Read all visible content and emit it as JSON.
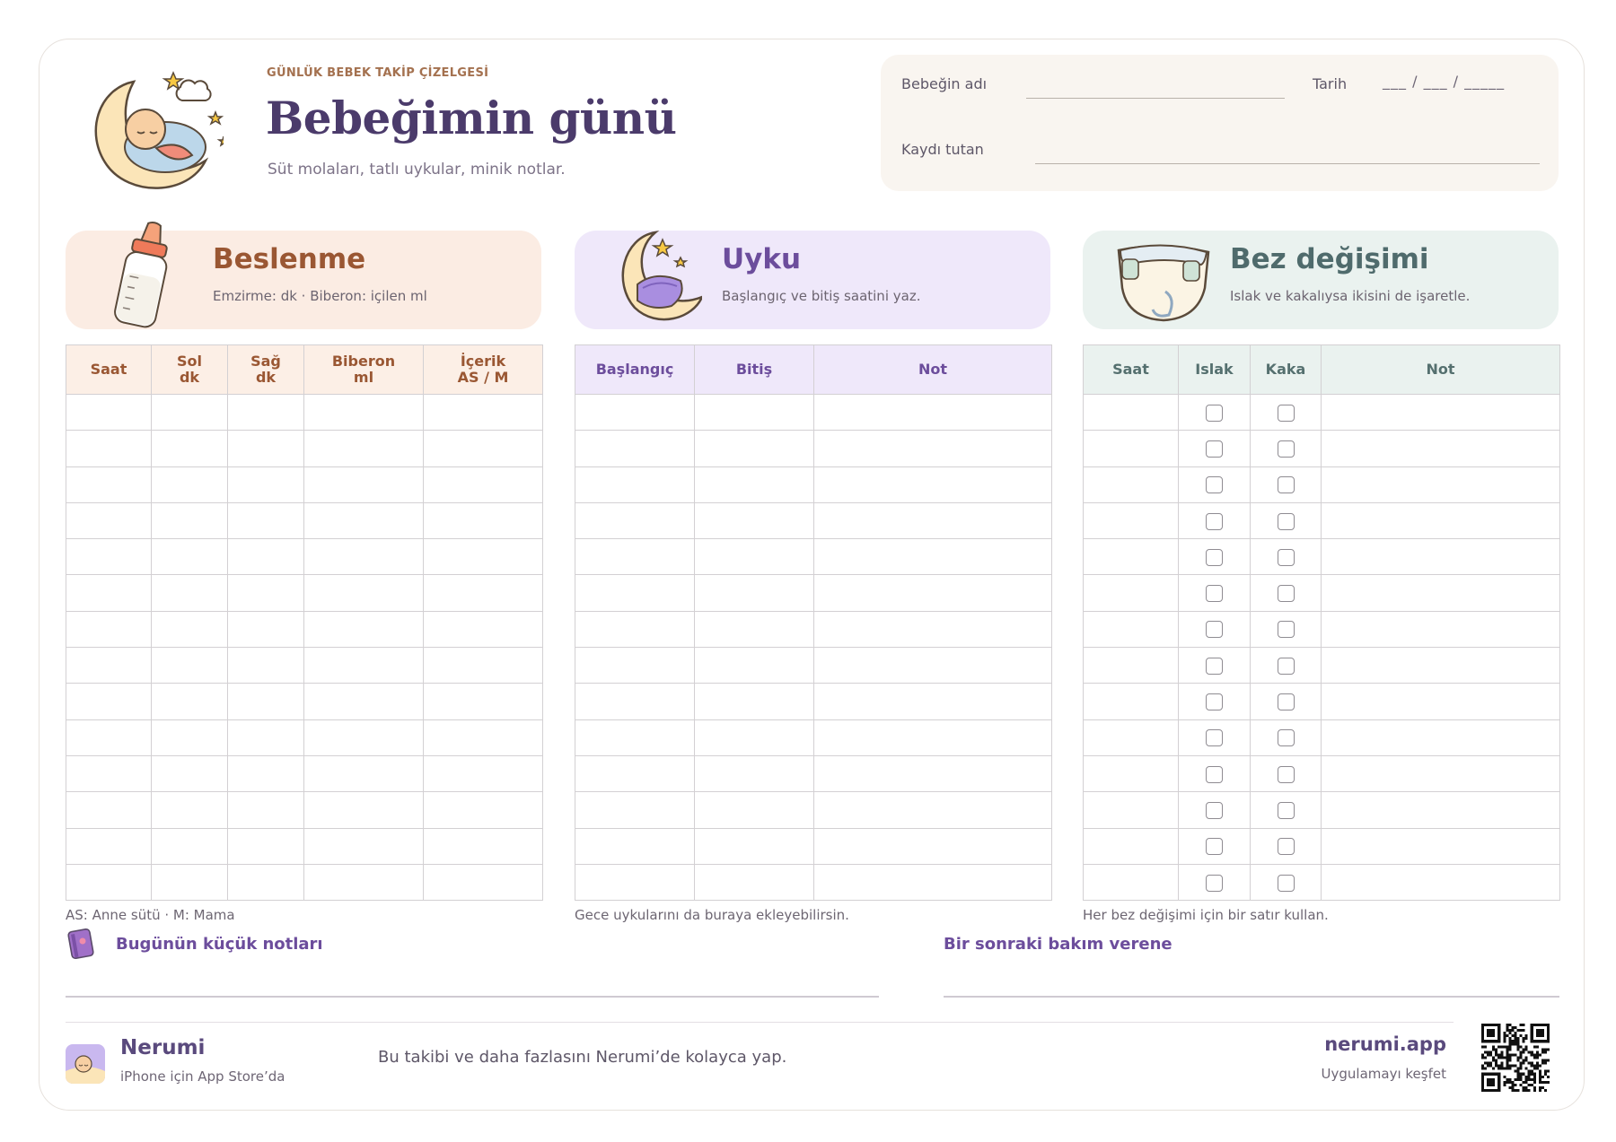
{
  "header": {
    "kicker": "GÜNLÜK BEBEK TAKİP ÇİZELGESİ",
    "title": "Bebeğimin günü",
    "subtitle": "Süt molaları, tatlı uykular, minik notlar.",
    "baby_name_label": "Bebeğin adı",
    "date_label": "Tarih",
    "date_blank": "___ / ___ / _____",
    "recorder_label": "Kaydı tutan"
  },
  "feeding": {
    "title": "Beslenme",
    "subtitle": "Emzirme: dk · Biberon: içilen ml",
    "columns": [
      {
        "l1": "Saat",
        "l2": ""
      },
      {
        "l1": "Sol",
        "l2": "dk"
      },
      {
        "l1": "Sağ",
        "l2": "dk"
      },
      {
        "l1": "Biberon",
        "l2": "ml"
      },
      {
        "l1": "İçerik",
        "l2": "AS / M"
      }
    ],
    "row_count": 14,
    "footnote": "AS: Anne sütü  ·  M: Mama"
  },
  "sleep": {
    "title": "Uyku",
    "subtitle": "Başlangıç ve bitiş saatini yaz.",
    "columns": [
      "Başlangıç",
      "Bitiş",
      "Not"
    ],
    "row_count": 14,
    "footnote": "Gece uykularını da buraya ekleyebilirsin."
  },
  "diaper": {
    "title": "Bez değişimi",
    "subtitle": "Islak ve kakalıysa ikisini de işaretle.",
    "columns": [
      "Saat",
      "Islak",
      "Kaka",
      "Not"
    ],
    "row_count": 14,
    "footnote": "Her bez değişimi için bir satır kullan."
  },
  "notes": {
    "today_label": "Bugünün küçük notları",
    "next_caregiver_label": "Bir sonraki bakım verene"
  },
  "footer": {
    "brand": "Nerumi",
    "brand_sub": "iPhone için App Store’da",
    "promo": "Bu takibi ve daha fazlasını Nerumi’de kolayca yap.",
    "site": "nerumi.app",
    "site_sub": "Uygulamayı keşfet"
  },
  "colors": {
    "feeding_accent": "#9a5733",
    "sleep_accent": "#6c4d9c",
    "diaper_accent": "#4f6b6c",
    "title": "#4b3b6b"
  },
  "icons": [
    "sleeping-baby-moon-icon",
    "baby-bottle-icon",
    "moon-blanket-icon",
    "diaper-icon",
    "notebook-icon",
    "nerumi-logo-icon",
    "qr-code"
  ]
}
